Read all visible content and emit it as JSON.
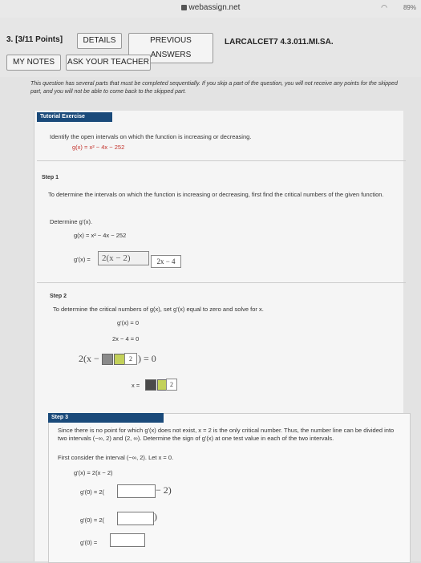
{
  "status": {
    "url": "webassign.net",
    "battery": "89%"
  },
  "question": {
    "number": "3.",
    "points": "[3/11 Points]",
    "code": "LARCALCET7 4.3.011.MI.SA."
  },
  "buttons": {
    "details": "DETAILS",
    "previous": "PREVIOUS ANSWERS",
    "my_notes": "MY NOTES",
    "ask_teacher": "ASK YOUR TEACHER"
  },
  "intro": "This question has several parts that must be completed sequentially. If you skip a part of the question, you will not receive any points for the skipped part, and you will not be able to come back to the skipped part.",
  "tutorial": {
    "heading": "Tutorial Exercise",
    "prompt": "Identify the open intervals on which the function is increasing or decreasing.",
    "function": "g(x) = x² − 4x − 252"
  },
  "step1": {
    "label": "Step 1",
    "text": "To determine the intervals on which the function is increasing or decreasing, first find the critical numbers of the given function.",
    "determine": "Determine g'(x).",
    "g": "g(x) = x² − 4x − 252",
    "gprime_label": "g'(x) =",
    "answer": "2(x − 2)",
    "hint": "2x − 4"
  },
  "step2": {
    "label": "Step 2",
    "text": "To determine the critical numbers of g(x), set g'(x) equal to zero and solve for x.",
    "eq1": "g'(x) = 0",
    "eq2": "2x − 4 = 0",
    "factor_lhs": "2(x −",
    "factor_rhs": ") = 0",
    "tile_val": "2",
    "x_eq": "x =",
    "x_val": "2"
  },
  "step3": {
    "label": "Step 3",
    "text1": "Since there is no point for which g'(x) does not exist, x = 2 is the only critical number. Thus, the number line can be divided into two intervals (−∞, 2) and (2, ∞). Determine the sign of g'(x) at one test value in each of the two intervals.",
    "text2": "First consider the interval (−∞, 2). Let x = 0.",
    "line1": "g'(x) = 2(x − 2)",
    "line2_lhs": "g'(0) = 2(",
    "line2_rhs": "− 2)",
    "line3_lhs": "g'(0) = 2(",
    "line3_rhs": ")",
    "line4_lhs": "g'(0) ="
  }
}
